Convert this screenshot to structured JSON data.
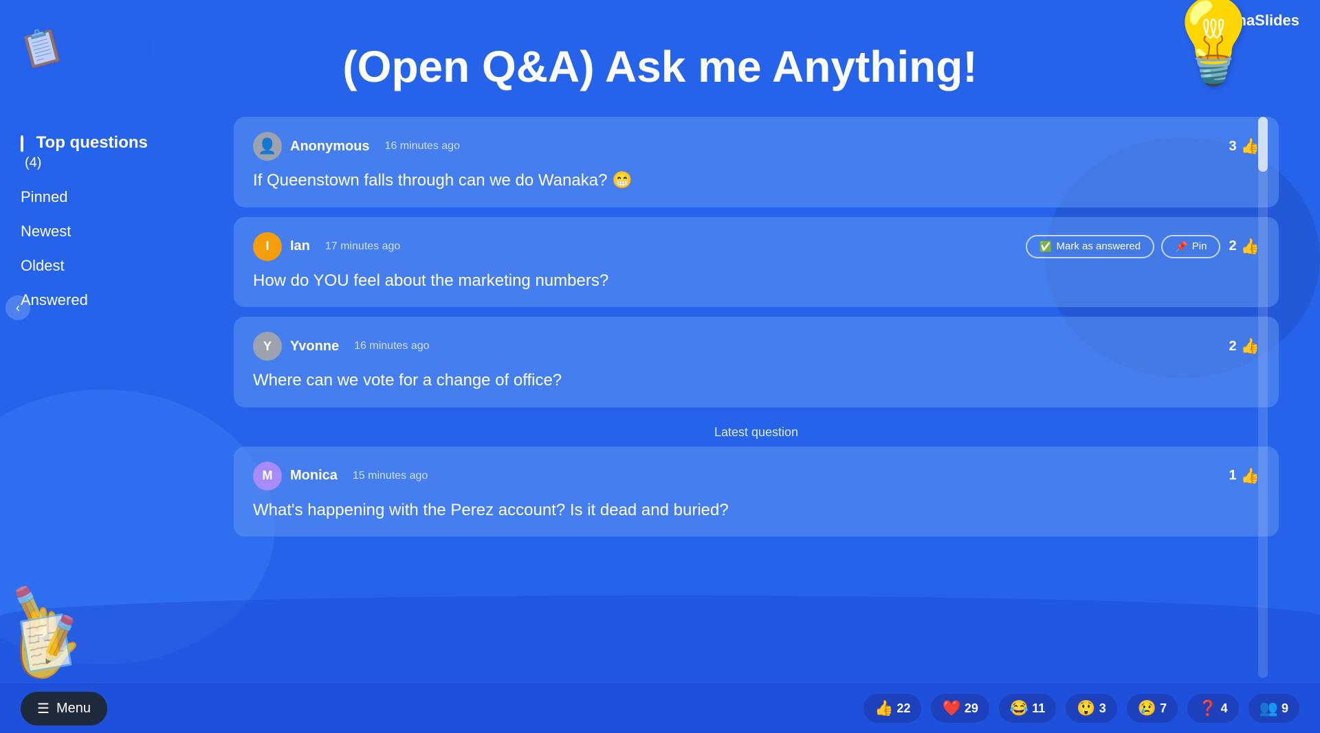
{
  "app": {
    "name": "AhaSlides",
    "logo_symbol": "A"
  },
  "page": {
    "title": "(Open Q&A) Ask me Anything!"
  },
  "sidebar": {
    "items": [
      {
        "id": "top-questions",
        "label": "Top questions",
        "badge": "(4)",
        "active": true
      },
      {
        "id": "pinned",
        "label": "Pinned",
        "active": false
      },
      {
        "id": "newest",
        "label": "Newest",
        "active": false
      },
      {
        "id": "oldest",
        "label": "Oldest",
        "active": false
      },
      {
        "id": "answered",
        "label": "Answered",
        "active": false
      }
    ]
  },
  "questions": [
    {
      "id": 1,
      "user": "Anonymous",
      "avatar_letter": "👤",
      "avatar_type": "anon",
      "time": "16 minutes ago",
      "text": "If Queenstown falls through can we do Wanaka? 😁",
      "likes": 3,
      "hovered": false
    },
    {
      "id": 2,
      "user": "Ian",
      "avatar_letter": "I",
      "avatar_type": "ian",
      "time": "17 minutes ago",
      "text": "How do YOU feel about the marketing numbers?",
      "likes": 2,
      "hovered": true,
      "actions": {
        "mark_answered": "Mark as answered",
        "pin": "Pin"
      }
    },
    {
      "id": 3,
      "user": "Yvonne",
      "avatar_letter": "Y",
      "avatar_type": "yvonne",
      "time": "16 minutes ago",
      "text": "Where can we vote for a change of office?",
      "likes": 2,
      "hovered": false
    },
    {
      "id": 4,
      "user": "Monica",
      "avatar_letter": "M",
      "avatar_type": "monica",
      "time": "15 minutes ago",
      "text": "What's happening with the Perez account? Is it dead and buried?",
      "likes": 1,
      "hovered": false,
      "is_latest": true
    }
  ],
  "latest_separator": "Latest question",
  "bottom_bar": {
    "menu_label": "Menu",
    "reactions": [
      {
        "emoji": "👍",
        "count": 22
      },
      {
        "emoji": "❤️",
        "count": 29
      },
      {
        "emoji": "😂",
        "count": 11
      },
      {
        "emoji": "😲",
        "count": 3
      },
      {
        "emoji": "😢",
        "count": 7
      },
      {
        "emoji": "❓",
        "count": 4
      },
      {
        "emoji": "👤",
        "count": 9
      }
    ]
  },
  "colors": {
    "primary": "#2563eb",
    "card_bg": "rgba(96, 150, 240, 0.55)",
    "avatar_anon": "#9ca3af",
    "avatar_ian": "#f59e0b",
    "avatar_yvonne": "#9ca3af",
    "avatar_monica": "#a78bfa"
  }
}
